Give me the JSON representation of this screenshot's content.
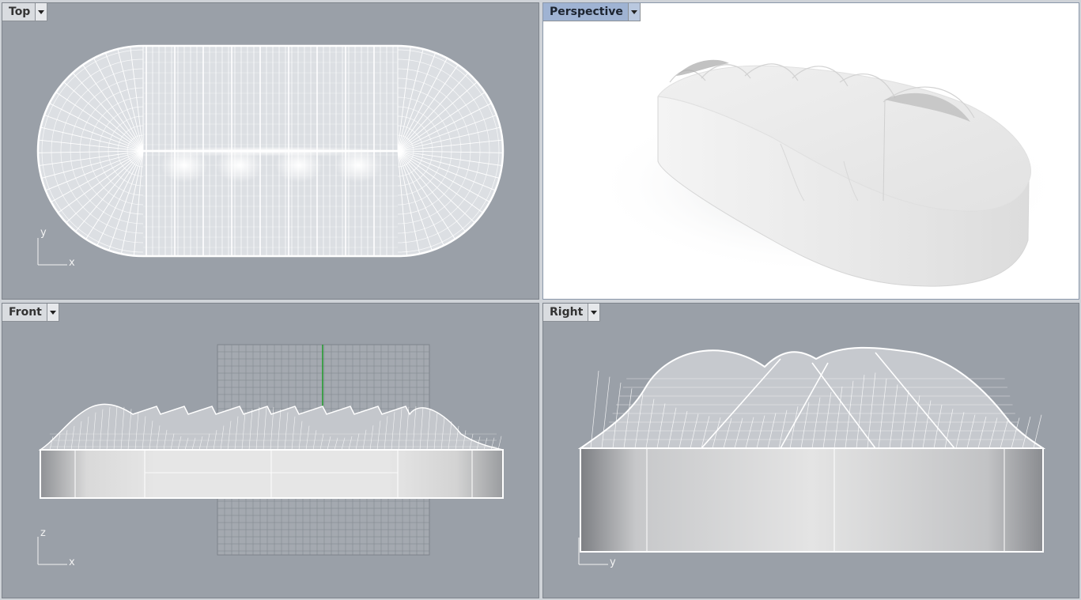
{
  "viewports": {
    "top": {
      "title": "Top",
      "axis_x": "x",
      "axis_y": "y"
    },
    "perspective": {
      "title": "Perspective"
    },
    "front": {
      "title": "Front",
      "axis_x": "x",
      "axis_y": "z"
    },
    "right": {
      "title": "Right",
      "axis_x": "y",
      "axis_y": "z"
    }
  },
  "colors": {
    "viewport_bg": "#9aa0a8",
    "active_tab": "#9fb3d3",
    "wire": "#ffffff",
    "grid_major_axis": "#1f9a2a"
  },
  "icons": {
    "dropdown": "caret-down",
    "axes": "axis-triad"
  }
}
